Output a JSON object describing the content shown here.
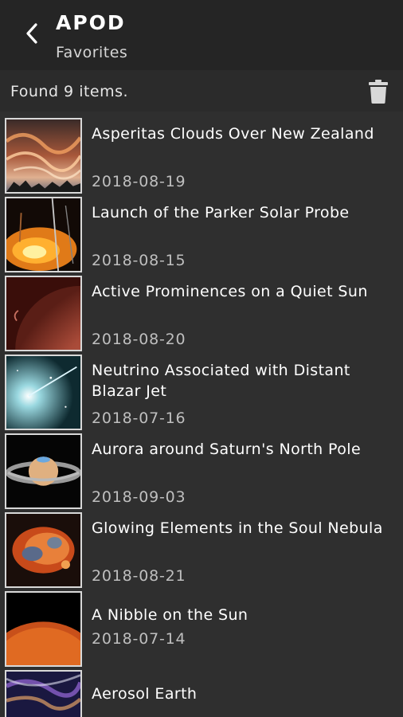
{
  "appbar": {
    "title": "APOD",
    "subtitle": "Favorites",
    "back_icon": "chevron-left-icon"
  },
  "status": {
    "found_text": "Found 9 items.",
    "trash_icon": "trash-icon"
  },
  "favorites": [
    {
      "title": "Asperitas Clouds Over New Zealand",
      "date": "2018-08-19"
    },
    {
      "title": "Launch of the Parker Solar Probe",
      "date": "2018-08-15"
    },
    {
      "title": "Active Prominences on a Quiet Sun",
      "date": "2018-08-20"
    },
    {
      "title": "Neutrino Associated with Distant Blazar Jet",
      "date": "2018-07-16"
    },
    {
      "title": "Aurora around Saturn's North Pole",
      "date": "2018-09-03"
    },
    {
      "title": "Glowing Elements in the Soul Nebula",
      "date": "2018-08-21"
    },
    {
      "title": "A Nibble on the Sun",
      "date": "2018-07-14"
    },
    {
      "title": "Aerosol Earth",
      "date": ""
    }
  ],
  "colors": {
    "appbar_bg": "#252525",
    "list_bg": "#2f2f2f",
    "date_text": "#bfbfbf"
  }
}
